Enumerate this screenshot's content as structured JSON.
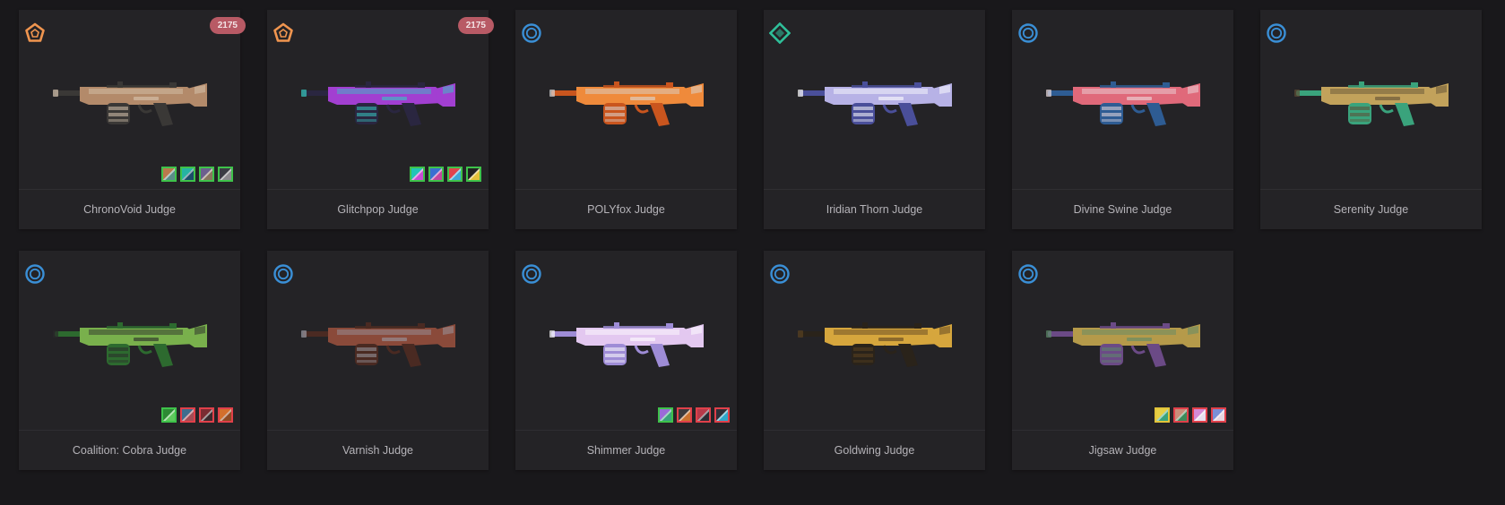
{
  "tier_colors": {
    "exclusive": "#f0954f",
    "ultra": "#2fbf9a",
    "deluxe": "#3a8fd6"
  },
  "swatch_colors": {
    "green": "#3ec24a",
    "red": "#e0404a",
    "yellow": "#e2c43a"
  },
  "skins": [
    {
      "name": "ChronoVoid Judge",
      "tier_icon": "pentagon-tier-icon",
      "tier": "exclusive",
      "price": "2175",
      "gun_colors": [
        "#3a3836",
        "#b38a6a",
        "#d8c6b0"
      ],
      "swatches": [
        {
          "fill": [
            "#b9794d",
            "#5a8c89"
          ],
          "border": "green"
        },
        {
          "fill": [
            "#26b3a3",
            "#1b4d6a"
          ],
          "border": "green"
        },
        {
          "fill": [
            "#6c5f8e",
            "#89745f"
          ],
          "border": "green"
        },
        {
          "fill": [
            "#3b3b44",
            "#8e8a90"
          ],
          "border": "green"
        }
      ]
    },
    {
      "name": "Glitchpop Judge",
      "tier_icon": "pentagon-tier-icon",
      "tier": "exclusive",
      "price": "2175",
      "gun_colors": [
        "#2a2640",
        "#a23fd1",
        "#36c8c1"
      ],
      "swatches": [
        {
          "fill": [
            "#22c5b7",
            "#c84cd4"
          ],
          "border": "green"
        },
        {
          "fill": [
            "#3b6fd1",
            "#c446a0"
          ],
          "border": "green"
        },
        {
          "fill": [
            "#e1444c",
            "#3fa8d6"
          ],
          "border": "green"
        },
        {
          "fill": [
            "#222222",
            "#e3c13a"
          ],
          "border": "green"
        }
      ]
    },
    {
      "name": "POLYfox Judge",
      "tier_icon": "circle-tier-icon",
      "tier": "deluxe",
      "gun_colors": [
        "#c9551e",
        "#ef8a3b",
        "#d8d8d8"
      ],
      "swatches": []
    },
    {
      "name": "Iridian Thorn Judge",
      "tier_icon": "diamond-tier-icon",
      "tier": "ultra",
      "gun_colors": [
        "#4a4f9a",
        "#b7b2e6",
        "#ffffff"
      ],
      "swatches": []
    },
    {
      "name": "Divine Swine Judge",
      "tier_icon": "circle-tier-icon",
      "tier": "deluxe",
      "gun_colors": [
        "#2e5c93",
        "#e0697a",
        "#ecdde0"
      ],
      "swatches": []
    },
    {
      "name": "Serenity Judge",
      "tier_icon": "circle-tier-icon",
      "tier": "deluxe",
      "gun_colors": [
        "#3aa37c",
        "#c2a25b",
        "#5e4d34"
      ],
      "swatches": []
    },
    {
      "name": "Coalition: Cobra Judge",
      "tier_icon": "circle-tier-icon",
      "tier": "deluxe",
      "gun_colors": [
        "#2d6a2f",
        "#79b04c",
        "#2a2a2a"
      ],
      "swatches": [
        {
          "fill": [
            "#2d8a34",
            "#5fc85d"
          ],
          "border": "green"
        },
        {
          "fill": [
            "#3e6d8e",
            "#a34d56"
          ],
          "border": "red"
        },
        {
          "fill": [
            "#7a2b32",
            "#3a2a2e"
          ],
          "border": "red"
        },
        {
          "fill": [
            "#d36f2c",
            "#8d4a22"
          ],
          "border": "red"
        }
      ]
    },
    {
      "name": "Varnish Judge",
      "tier_icon": "circle-tier-icon",
      "tier": "deluxe",
      "gun_colors": [
        "#4a2a22",
        "#8a4a3a",
        "#9a9aa4"
      ],
      "swatches": []
    },
    {
      "name": "Shimmer Judge",
      "tier_icon": "circle-tier-icon",
      "tier": "deluxe",
      "gun_colors": [
        "#9e8cd6",
        "#e3c8f0",
        "#ffffff"
      ],
      "swatches": [
        {
          "fill": [
            "#9b6ad8",
            "#3aa37c"
          ],
          "border": "green"
        },
        {
          "fill": [
            "#3b3a3c",
            "#c9722e"
          ],
          "border": "red"
        },
        {
          "fill": [
            "#b63a4a",
            "#2c2c34"
          ],
          "border": "red"
        },
        {
          "fill": [
            "#2f2f38",
            "#2fa6c9"
          ],
          "border": "red"
        }
      ]
    },
    {
      "name": "Goldwing Judge",
      "tier_icon": "circle-tier-icon",
      "tier": "deluxe",
      "gun_colors": [
        "#2a231a",
        "#d6a63d",
        "#5a4121"
      ],
      "swatches": []
    },
    {
      "name": "Jigsaw Judge",
      "tier_icon": "circle-tier-icon",
      "tier": "deluxe",
      "gun_colors": [
        "#6b4a86",
        "#b59a4a",
        "#5c8a6a"
      ],
      "swatches": [
        {
          "fill": [
            "#e6cf46",
            "#3aa37c"
          ],
          "border": "yellow"
        },
        {
          "fill": [
            "#c98e7a",
            "#3d8a5a"
          ],
          "border": "red"
        },
        {
          "fill": [
            "#d48ad6",
            "#e6dff0"
          ],
          "border": "red"
        },
        {
          "fill": [
            "#7a8fd6",
            "#e6d6e0"
          ],
          "border": "red"
        }
      ]
    }
  ]
}
